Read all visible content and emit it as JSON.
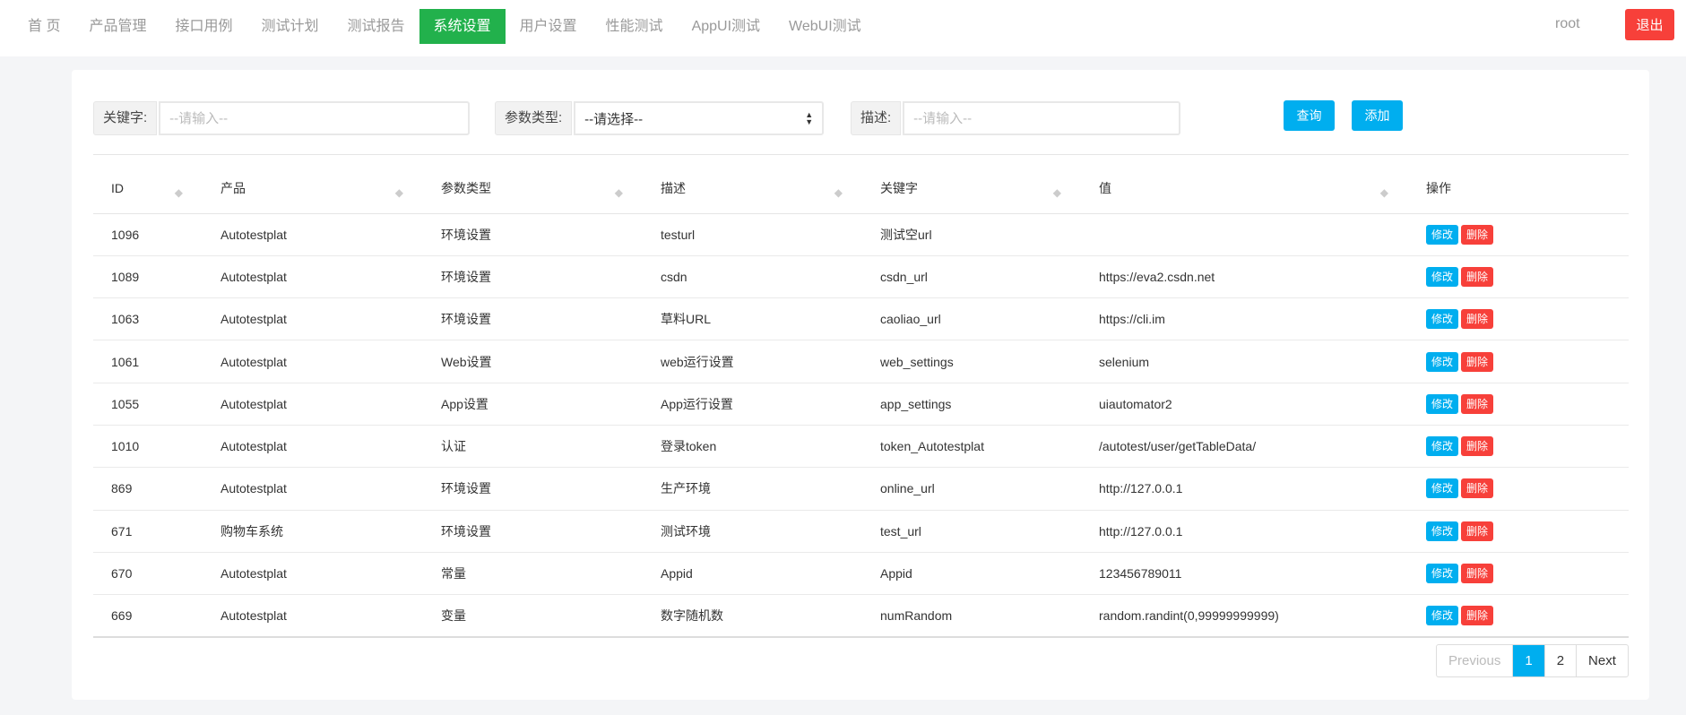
{
  "nav": {
    "items": [
      "首 页",
      "产品管理",
      "接口用例",
      "测试计划",
      "测试报告",
      "系统设置",
      "用户设置",
      "性能测试",
      "AppUI测试",
      "WebUI测试"
    ],
    "active": 5,
    "user": "root",
    "logout": "退出"
  },
  "filters": {
    "keyword_label": "关键字:",
    "keyword_placeholder": "--请输入--",
    "type_label": "参数类型:",
    "type_value": "--请选择--",
    "desc_label": "描述:",
    "desc_placeholder": "--请输入--",
    "query": "查询",
    "add": "添加"
  },
  "table": {
    "headers": [
      "ID",
      "产品",
      "参数类型",
      "描述",
      "关键字",
      "值",
      "操作"
    ],
    "edit": "修改",
    "delete": "删除",
    "rows": [
      [
        "1096",
        "Autotestplat",
        "环境设置",
        "testurl",
        "测试空url",
        ""
      ],
      [
        "1089",
        "Autotestplat",
        "环境设置",
        "csdn",
        "csdn_url",
        "https://eva2.csdn.net"
      ],
      [
        "1063",
        "Autotestplat",
        "环境设置",
        "草料URL",
        "caoliao_url",
        "https://cli.im"
      ],
      [
        "1061",
        "Autotestplat",
        "Web设置",
        "web运行设置",
        "web_settings",
        "selenium"
      ],
      [
        "1055",
        "Autotestplat",
        "App设置",
        "App运行设置",
        "app_settings",
        "uiautomator2"
      ],
      [
        "1010",
        "Autotestplat",
        "认证",
        "登录token",
        "token_Autotestplat",
        "/autotest/user/getTableData/"
      ],
      [
        "869",
        "Autotestplat",
        "环境设置",
        "生产环境",
        "online_url",
        "http://127.0.0.1"
      ],
      [
        "671",
        "购物车系统",
        "环境设置",
        "测试环境",
        "test_url",
        "http://127.0.0.1"
      ],
      [
        "670",
        "Autotestplat",
        "常量",
        "Appid",
        "Appid",
        "123456789011"
      ],
      [
        "669",
        "Autotestplat",
        "变量",
        "数字随机数",
        "numRandom",
        "random.randint(0,99999999999)"
      ]
    ]
  },
  "pagination": {
    "previous": "Previous",
    "pages": [
      "1",
      "2"
    ],
    "current": "1",
    "next": "Next"
  }
}
